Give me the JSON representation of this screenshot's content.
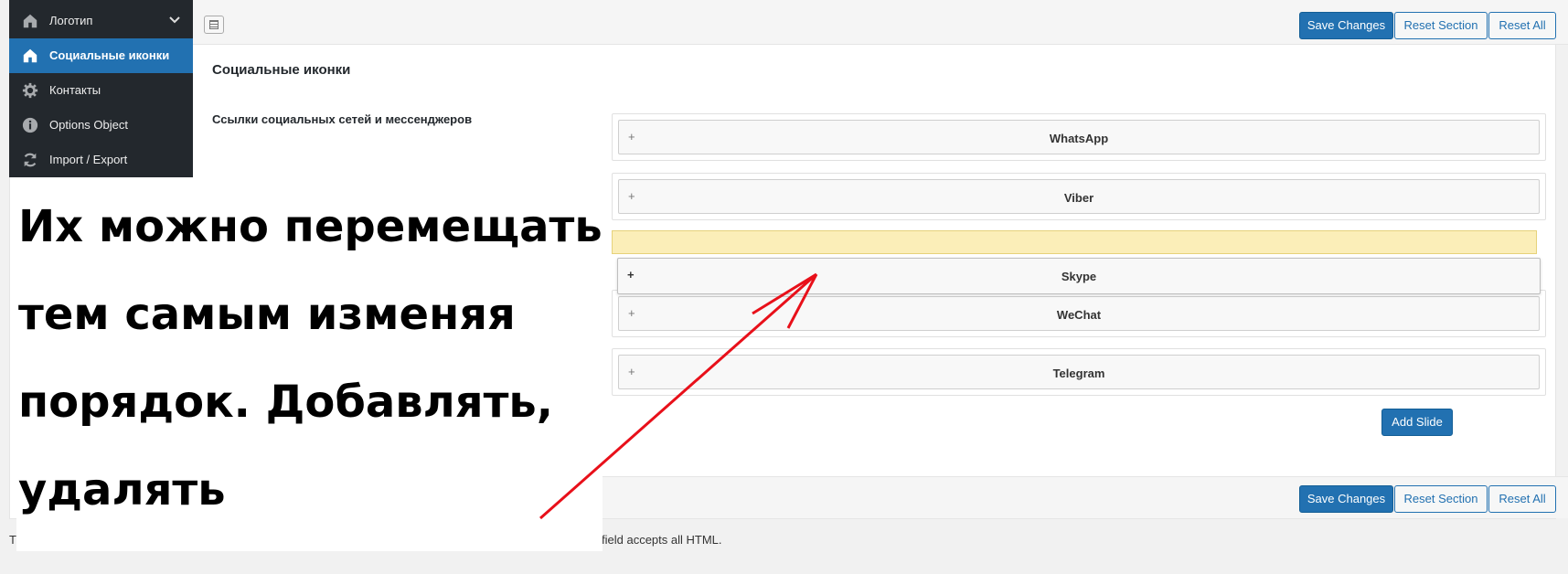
{
  "sidebar": {
    "items": [
      {
        "label": "Логотип",
        "icon": "home-icon"
      },
      {
        "label": "Социальные иконки",
        "icon": "home-icon"
      },
      {
        "label": "Контакты",
        "icon": "gear-icon"
      },
      {
        "label": "Options Object",
        "icon": "info-icon"
      },
      {
        "label": "Import / Export",
        "icon": "refresh-icon"
      }
    ]
  },
  "toolbar": {
    "save_label": "Save Changes",
    "reset_section_label": "Reset Section",
    "reset_all_label": "Reset All"
  },
  "section": {
    "title": "Социальные иконки",
    "field_label": "Ссылки социальных сетей и мессенджеров"
  },
  "slides": {
    "items": [
      "WhatsApp",
      "Viber",
      "Skype",
      "WeChat",
      "Telegram"
    ],
    "plus": "+",
    "add_label": "Add Slide"
  },
  "overlay": {
    "line1": "Их можно перемещать",
    "line2": "тем самым изменяя",
    "line3": "порядок. Добавлять,",
    "line4": "удалять"
  },
  "footer": {
    "note_start": "Th",
    "note_end": "field accepts all HTML."
  },
  "colors": {
    "accent": "#2271b1",
    "sidebar_bg": "#23282d",
    "placeholder": "#fbeeb8",
    "annotation_arrow": "#e8101a"
  }
}
